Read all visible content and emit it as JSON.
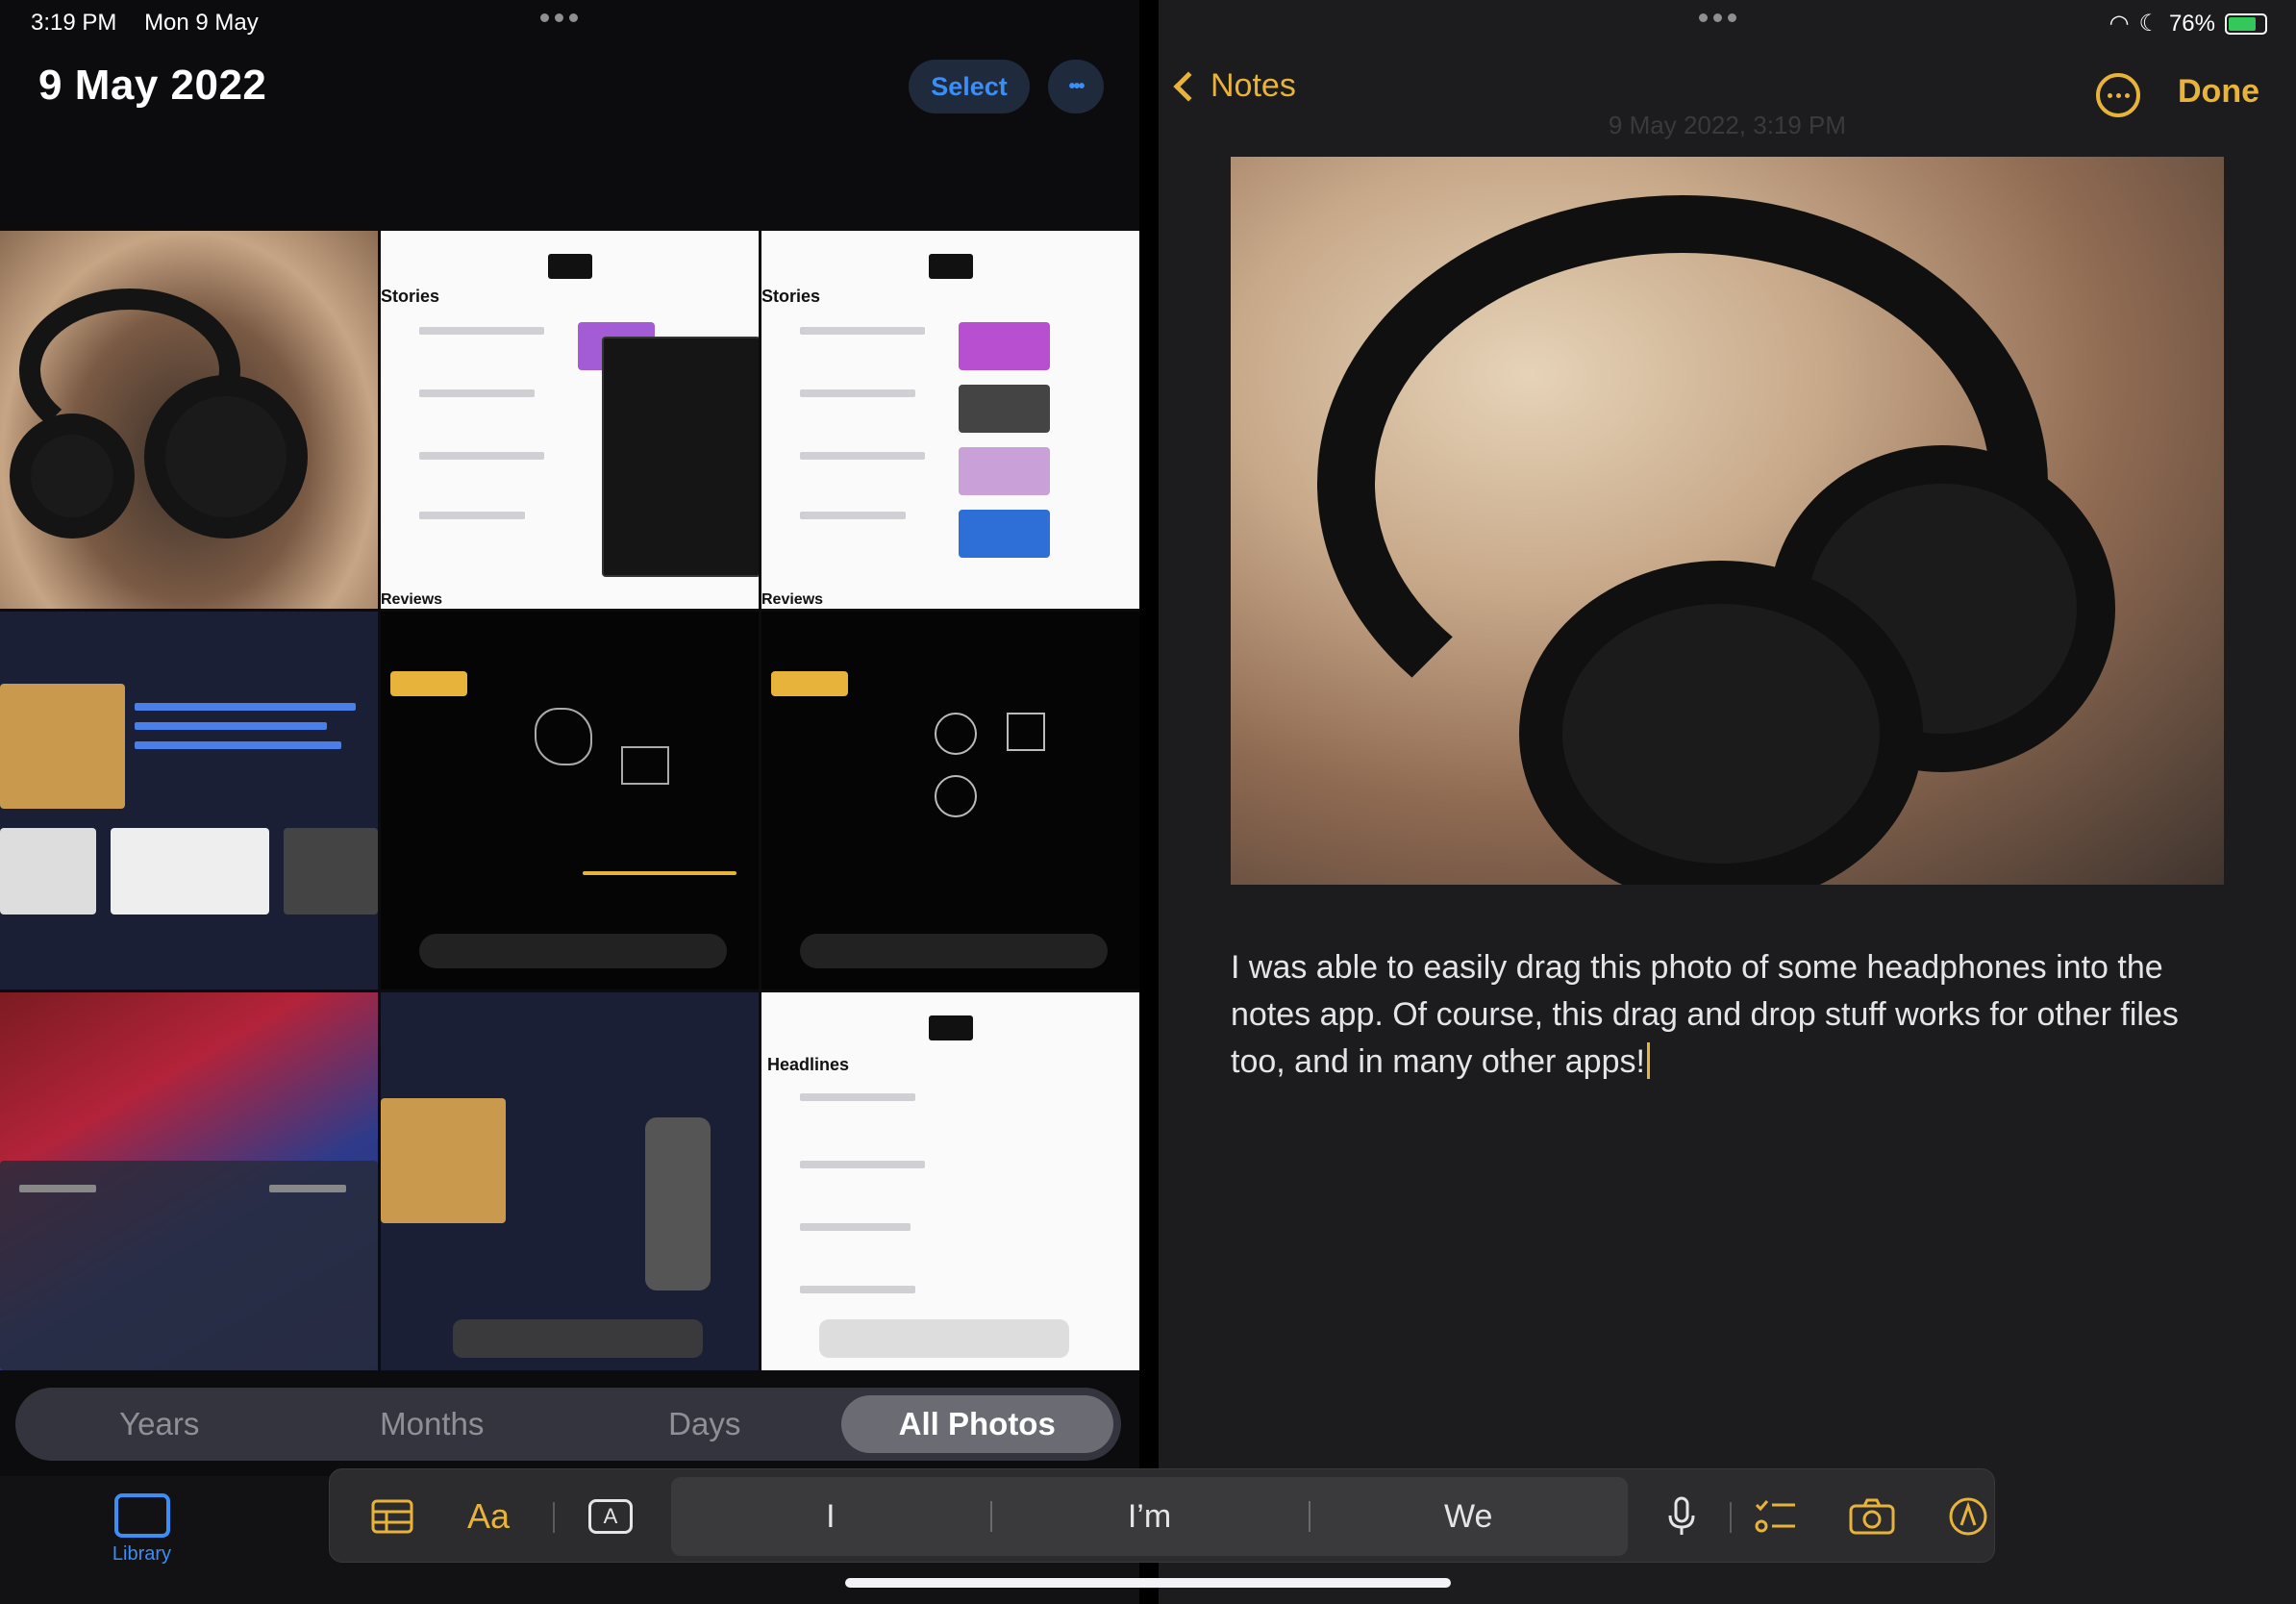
{
  "status_bar": {
    "time": "3:19 PM",
    "date": "Mon 9 May",
    "battery_percent": "76%",
    "battery_level": 0.76
  },
  "photos": {
    "title": "9 May 2022",
    "select_label": "Select",
    "more_label": "•••",
    "view_tabs": [
      {
        "label": "Years",
        "active": false
      },
      {
        "label": "Months",
        "active": false
      },
      {
        "label": "Days",
        "active": false
      },
      {
        "label": "All Photos",
        "active": true
      }
    ],
    "tabbar": {
      "library_label": "Library",
      "library_icon": "photo-library-icon"
    },
    "thumbnail_texts": {
      "stories": "Stories",
      "reviews": "Reviews",
      "headlines": "Headlines"
    }
  },
  "notes": {
    "back_label": "Notes",
    "done_label": "Done",
    "date_stamp": "9 May 2022, 3:19 PM",
    "body": "I was able to easily drag this photo of some headphones into the notes app. Of course, this drag and drop stuff works for other files too, and in many other apps!"
  },
  "shortcut_bar": {
    "predictions": [
      "I",
      "I’m",
      "We"
    ],
    "icons": [
      "table-icon",
      "text-format-icon",
      "text-box-icon",
      "microphone-icon",
      "checklist-icon",
      "camera-icon",
      "markup-icon"
    ],
    "text_format_label": "Aa",
    "text_box_label": "A"
  },
  "colors": {
    "notes_accent": "#e8b33a",
    "photos_accent": "#3b8ef6"
  }
}
